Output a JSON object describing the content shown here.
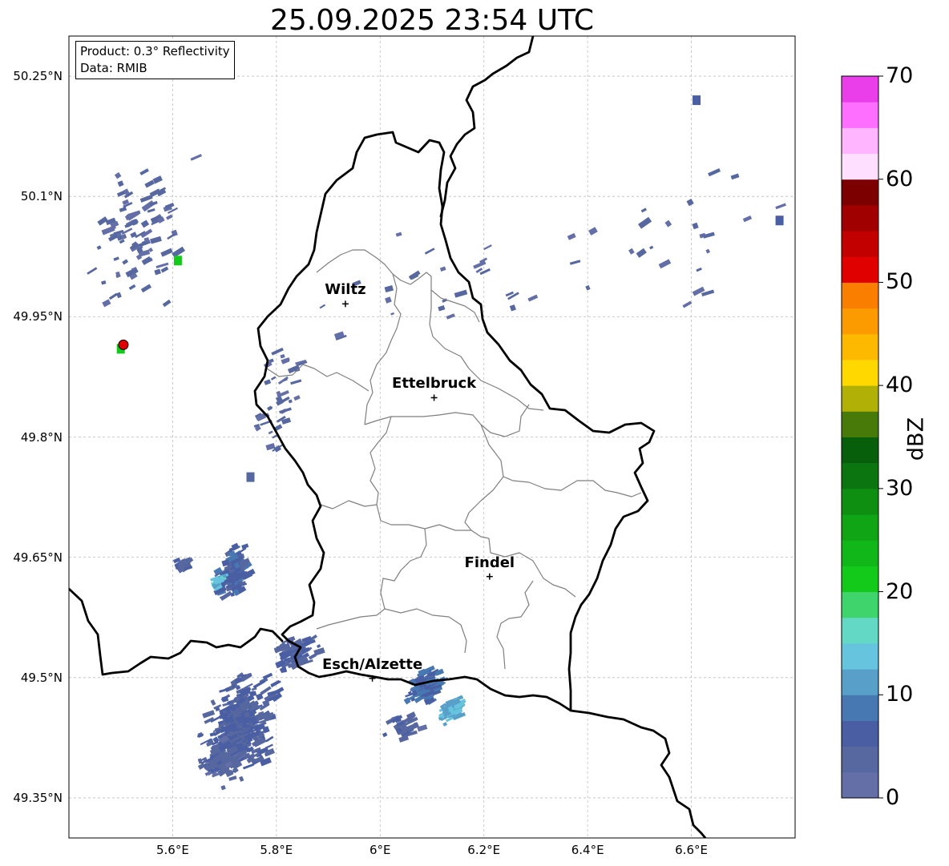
{
  "title": "25.09.2025 23:54 UTC",
  "info_box": {
    "product_line": "Product: 0.3° Reflectivity",
    "data_line": "Data: RMIB"
  },
  "axes": {
    "lat_ticks": [
      {
        "value": 50.25,
        "label": "50.25°N"
      },
      {
        "value": 50.1,
        "label": "50.1°N"
      },
      {
        "value": 49.95,
        "label": "49.95°N"
      },
      {
        "value": 49.8,
        "label": "49.8°N"
      },
      {
        "value": 49.65,
        "label": "49.65°N"
      },
      {
        "value": 49.5,
        "label": "49.5°N"
      },
      {
        "value": 49.35,
        "label": "49.35°N"
      }
    ],
    "lon_ticks": [
      {
        "value": 5.6,
        "label": "5.6°E"
      },
      {
        "value": 5.8,
        "label": "5.8°E"
      },
      {
        "value": 6.0,
        "label": "6°E"
      },
      {
        "value": 6.2,
        "label": "6.2°E"
      },
      {
        "value": 6.4,
        "label": "6.4°E"
      },
      {
        "value": 6.6,
        "label": "6.6°E"
      }
    ],
    "lon_range": [
      5.4,
      6.8
    ],
    "lat_range": [
      49.3,
      50.3
    ],
    "grid": true
  },
  "cities": [
    {
      "name": "Wiltz",
      "lon": 5.933,
      "lat": 49.966
    },
    {
      "name": "Ettelbruck",
      "lon": 6.104,
      "lat": 49.849
    },
    {
      "name": "Findel",
      "lon": 6.211,
      "lat": 49.626
    },
    {
      "name": "Esch/Alzette",
      "lon": 5.985,
      "lat": 49.499
    }
  ],
  "radar_site": {
    "lon": 5.505,
    "lat": 49.915,
    "color": "#e00000"
  },
  "colorbar": {
    "label": "dBZ",
    "min": 0,
    "max": 70,
    "step": 2.5,
    "ticks": [
      0,
      10,
      20,
      30,
      40,
      50,
      60,
      70
    ],
    "colors": [
      "#646fa8",
      "#57679f",
      "#4a5fa3",
      "#4878b2",
      "#58a0c9",
      "#66c4de",
      "#62d8c5",
      "#3fd46c",
      "#13c919",
      "#11b718",
      "#10a514",
      "#0f8f12",
      "#0b7610",
      "#075e0b",
      "#477a08",
      "#b0b006",
      "#ffd800",
      "#fdb900",
      "#fb9b00",
      "#fa7f00",
      "#e00000",
      "#c30000",
      "#a00000",
      "#7d0000",
      "#ffdfff",
      "#ffb5ff",
      "#ff6fff",
      "#ea3eea"
    ]
  },
  "echoes": [
    {
      "lon": 5.72,
      "lat": 49.44,
      "dlon": 0.08,
      "dlat": 0.08,
      "n": 360,
      "dbz": 5
    },
    {
      "lon": 5.69,
      "lat": 49.4,
      "dlon": 0.05,
      "dlat": 0.03,
      "n": 90,
      "dbz": 4
    },
    {
      "lon": 5.83,
      "lat": 49.53,
      "dlon": 0.05,
      "dlat": 0.025,
      "n": 70,
      "dbz": 5
    },
    {
      "lon": 6.08,
      "lat": 49.49,
      "dlon": 0.035,
      "dlat": 0.025,
      "n": 120,
      "dbz": 8
    },
    {
      "lon": 6.13,
      "lat": 49.46,
      "dlon": 0.025,
      "dlat": 0.02,
      "n": 60,
      "dbz": 12
    },
    {
      "lon": 6.04,
      "lat": 49.44,
      "dlon": 0.04,
      "dlat": 0.02,
      "n": 30,
      "dbz": 4
    },
    {
      "lon": 5.71,
      "lat": 49.63,
      "dlon": 0.035,
      "dlat": 0.04,
      "n": 130,
      "dbz": 6
    },
    {
      "lon": 5.68,
      "lat": 49.62,
      "dlon": 0.012,
      "dlat": 0.01,
      "n": 20,
      "dbz": 14
    },
    {
      "lon": 5.61,
      "lat": 49.64,
      "dlon": 0.02,
      "dlat": 0.012,
      "n": 25,
      "dbz": 5
    },
    {
      "lon": 5.53,
      "lat": 50.05,
      "dlon": 0.12,
      "dlat": 0.12,
      "n": 90,
      "dbz": 3
    },
    {
      "lon": 5.8,
      "lat": 49.85,
      "dlon": 0.06,
      "dlat": 0.1,
      "n": 40,
      "dbz": 3
    },
    {
      "lon": 6.12,
      "lat": 50.0,
      "dlon": 0.35,
      "dlat": 0.1,
      "n": 30,
      "dbz": 3
    },
    {
      "lon": 6.6,
      "lat": 50.05,
      "dlon": 0.2,
      "dlat": 0.12,
      "n": 20,
      "dbz": 3
    }
  ],
  "point_echoes": [
    {
      "lon": 6.61,
      "lat": 50.22,
      "dbz": 6
    },
    {
      "lon": 6.77,
      "lat": 50.07,
      "dbz": 5
    },
    {
      "lon": 5.61,
      "lat": 50.02,
      "dbz": 22
    },
    {
      "lon": 5.5,
      "lat": 49.91,
      "dbz": 22
    },
    {
      "lon": 5.75,
      "lat": 49.75,
      "dbz": 4
    }
  ]
}
